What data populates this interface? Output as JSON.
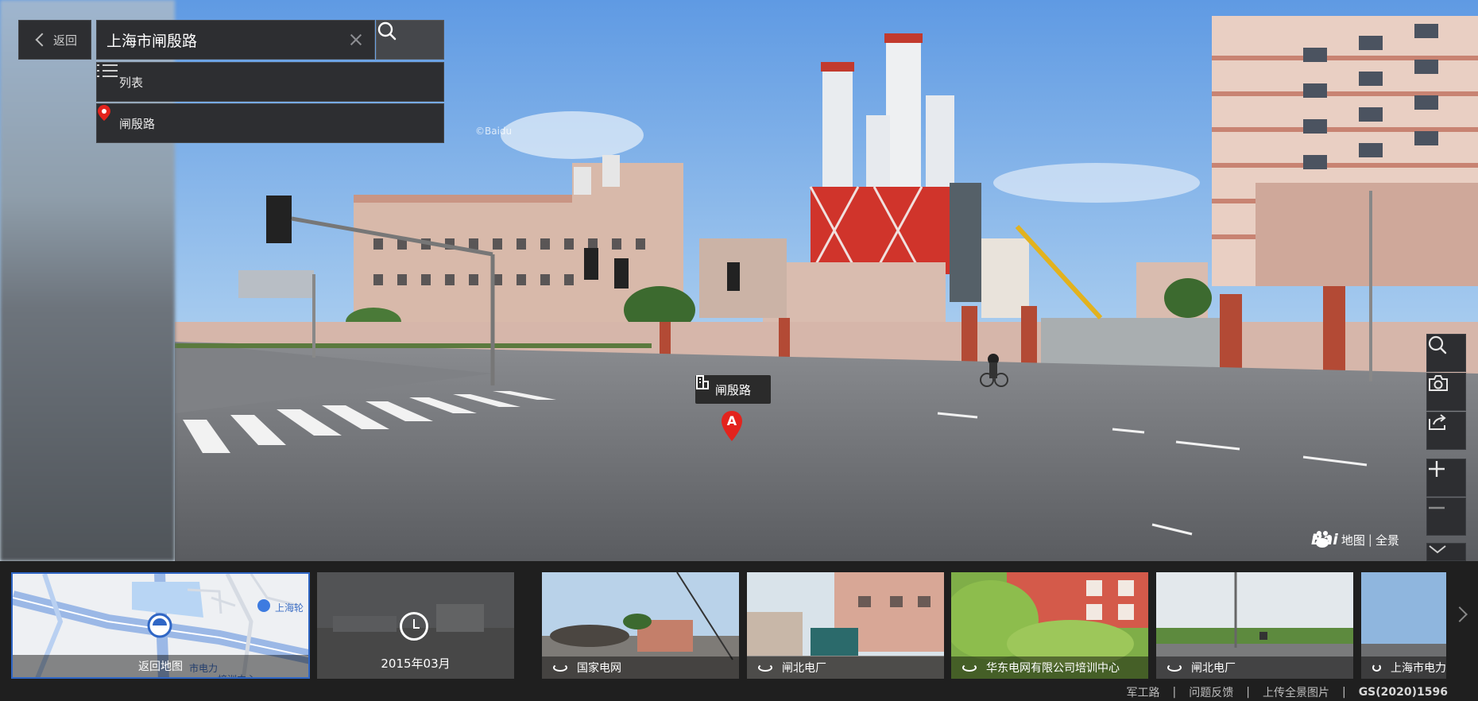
{
  "toolbar": {
    "back_label": "返回"
  },
  "search": {
    "value": "上海市闸殷路"
  },
  "dropdown": [
    {
      "label": "列表",
      "icon": "list-icon"
    },
    {
      "label": "闸殷路",
      "icon": "map-pin-icon"
    }
  ],
  "marker": {
    "label": "闸殷路",
    "pin_letter": "A"
  },
  "watermark": "©Baidu",
  "logo": {
    "brand": "Bai",
    "map": "地图",
    "pano": "全景"
  },
  "right_tools": [
    "search-icon",
    "camera-icon",
    "share-icon",
    "zoom-in-icon",
    "zoom-out-icon",
    "collapse-icon"
  ],
  "strip": {
    "map_thumb": {
      "caption": "返回地图",
      "map_labels": [
        "上海轮",
        "市电力",
        "培训中心"
      ]
    },
    "time_thumb": {
      "date": "2015年03月"
    },
    "nearby": [
      {
        "label": "国家电网"
      },
      {
        "label": "闸北电厂"
      },
      {
        "label": "华东电网有限公司培训中心"
      },
      {
        "label": "闸北电厂"
      },
      {
        "label": "上海市电力"
      }
    ]
  },
  "footer": {
    "links": [
      "军工路",
      "问题反馈",
      "上传全景图片"
    ],
    "separator": "|",
    "license": "GS(2020)1596"
  },
  "colors": {
    "accent": "#2f66c5",
    "pin": "#e3231d",
    "panel": "#2d2e31"
  }
}
